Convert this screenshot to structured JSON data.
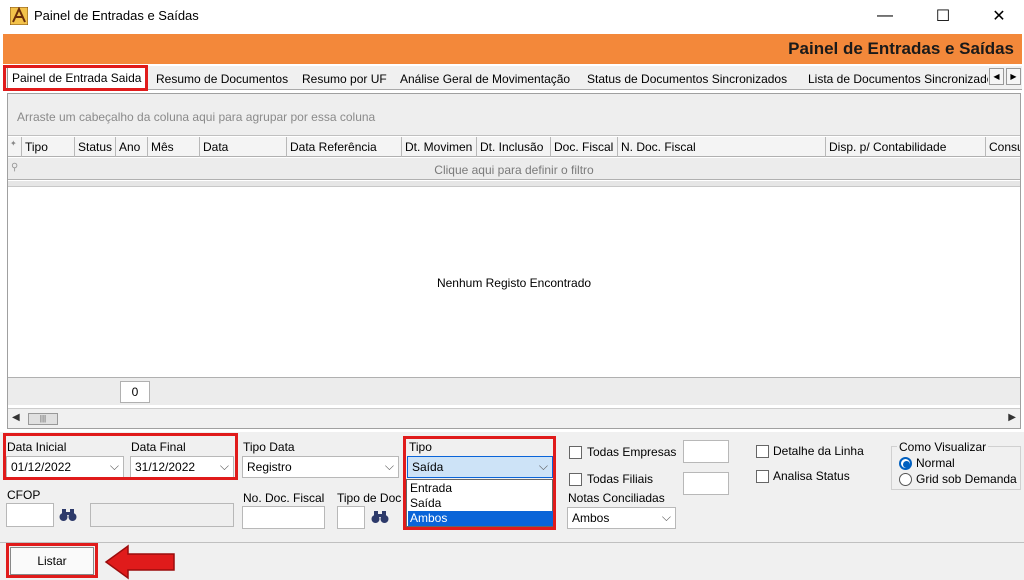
{
  "window": {
    "title": "Painel de Entradas e Saídas",
    "minimize": "—",
    "maximize": "☐",
    "close": "✕"
  },
  "header": {
    "title": "Painel de Entradas e Saídas"
  },
  "tabs": [
    {
      "label": "Painel de Entrada Saida",
      "active": true
    },
    {
      "label": "Resumo de Documentos"
    },
    {
      "label": "Resumo por UF"
    },
    {
      "label": "Análise Geral de Movimentação"
    },
    {
      "label": "Status de Documentos Sincronizados"
    },
    {
      "label": "Lista de Documentos Sincronizados"
    }
  ],
  "tab_scroll": {
    "left": "◀",
    "right": "▶"
  },
  "grid": {
    "group_hint": "Arraste um cabeçalho da coluna aqui para agrupar por essa coluna",
    "columns": [
      "Tipo",
      "Status",
      "Ano",
      "Mês",
      "Data",
      "Data Referência",
      "Dt. Movimen",
      "Dt. Inclusão",
      "Doc. Fiscal",
      "N. Doc. Fiscal",
      "Disp. p/ Contabilidade",
      "Consu"
    ],
    "filter_hint": "Clique aqui para definir o filtro",
    "empty_message": "Nenhum Registo Encontrado",
    "footer_count": "0",
    "scroll_left": "◀",
    "scroll_right": "▶",
    "scroll_thumb": "|||"
  },
  "filters": {
    "data_inicial": {
      "label": "Data Inicial",
      "value": "01/12/2022"
    },
    "data_final": {
      "label": "Data Final",
      "value": "31/12/2022"
    },
    "tipo_data": {
      "label": "Tipo Data",
      "value": "Registro"
    },
    "tipo": {
      "label": "Tipo",
      "value": "Saída",
      "options": [
        "Entrada",
        "Saída",
        "Ambos"
      ],
      "highlighted": "Ambos"
    },
    "todas_empresas": {
      "label": "Todas Empresas"
    },
    "todas_filiais": {
      "label": "Todas Filiais"
    },
    "notas_conciliadas": {
      "label": "Notas Conciliadas",
      "value": "Ambos"
    },
    "detalhe_linha": {
      "label": "Detalhe da Linha"
    },
    "analisa_status": {
      "label": "Analisa Status"
    },
    "como_visualizar": {
      "label": "Como Visualizar",
      "options": [
        "Normal",
        "Grid sob Demanda"
      ],
      "selected": "Normal"
    },
    "cfop": {
      "label": "CFOP"
    },
    "no_doc_fiscal": {
      "label": "No. Doc. Fiscal"
    },
    "tipo_doc": {
      "label": "Tipo de Doc"
    },
    "dropdown_arrow": "⌵"
  },
  "actions": {
    "listar": "Listar"
  },
  "colors": {
    "accent": "#f3883a",
    "highlight": "#e01b1b",
    "selection": "#0a64d8"
  }
}
